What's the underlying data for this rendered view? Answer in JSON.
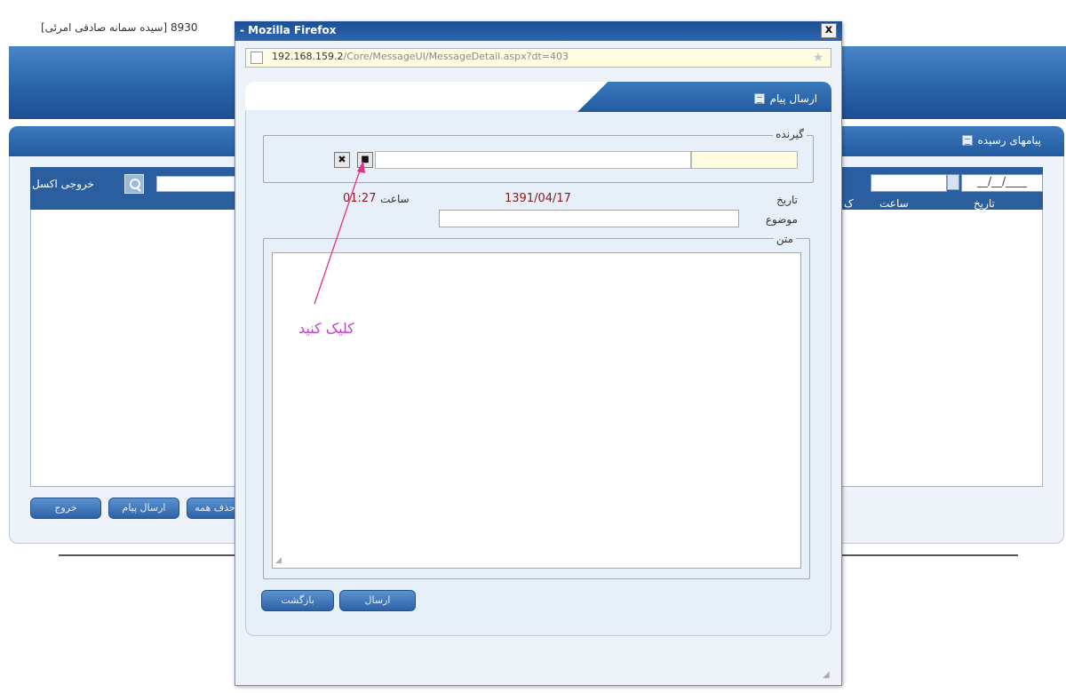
{
  "background": {
    "title_text": "8930 [سیده سمانه صادقی امرئی]",
    "inbox_title": "پیامهای رسیده",
    "excel_label": "خروجی اکسل",
    "right_grid": {
      "date_input_value": "__/__/____",
      "columns": [
        "تاریخ",
        "ساعت",
        "ک"
      ]
    },
    "buttons": {
      "exit": "خروج",
      "send": "ارسال پیام",
      "delete": "حذف همه"
    }
  },
  "popup": {
    "window_title": "- Mozilla Firefox",
    "close_glyph": "x",
    "url_host": "192.168.159.2",
    "url_path": "/Core/MessageUI/MessageDetail.aspx?dt=403",
    "form_title": "ارسال پیام",
    "recipient_legend": "گیرنده",
    "select_glyph": "■",
    "clear_glyph": "✖",
    "date_label": "تاریخ",
    "date_value": "1391/04/17",
    "time_label": "ساعت",
    "time_value": "01:27",
    "subject_label": "موضوع",
    "body_legend": "متن",
    "send_button": "ارسال",
    "back_button": "بازگشت"
  },
  "annotation": {
    "text": "کلیک کنید",
    "color": "#c43bd0"
  },
  "colors": {
    "header_blue": "#2a64ab",
    "grid_header": "#2b5e9e",
    "value_red": "#8b1a1a"
  }
}
